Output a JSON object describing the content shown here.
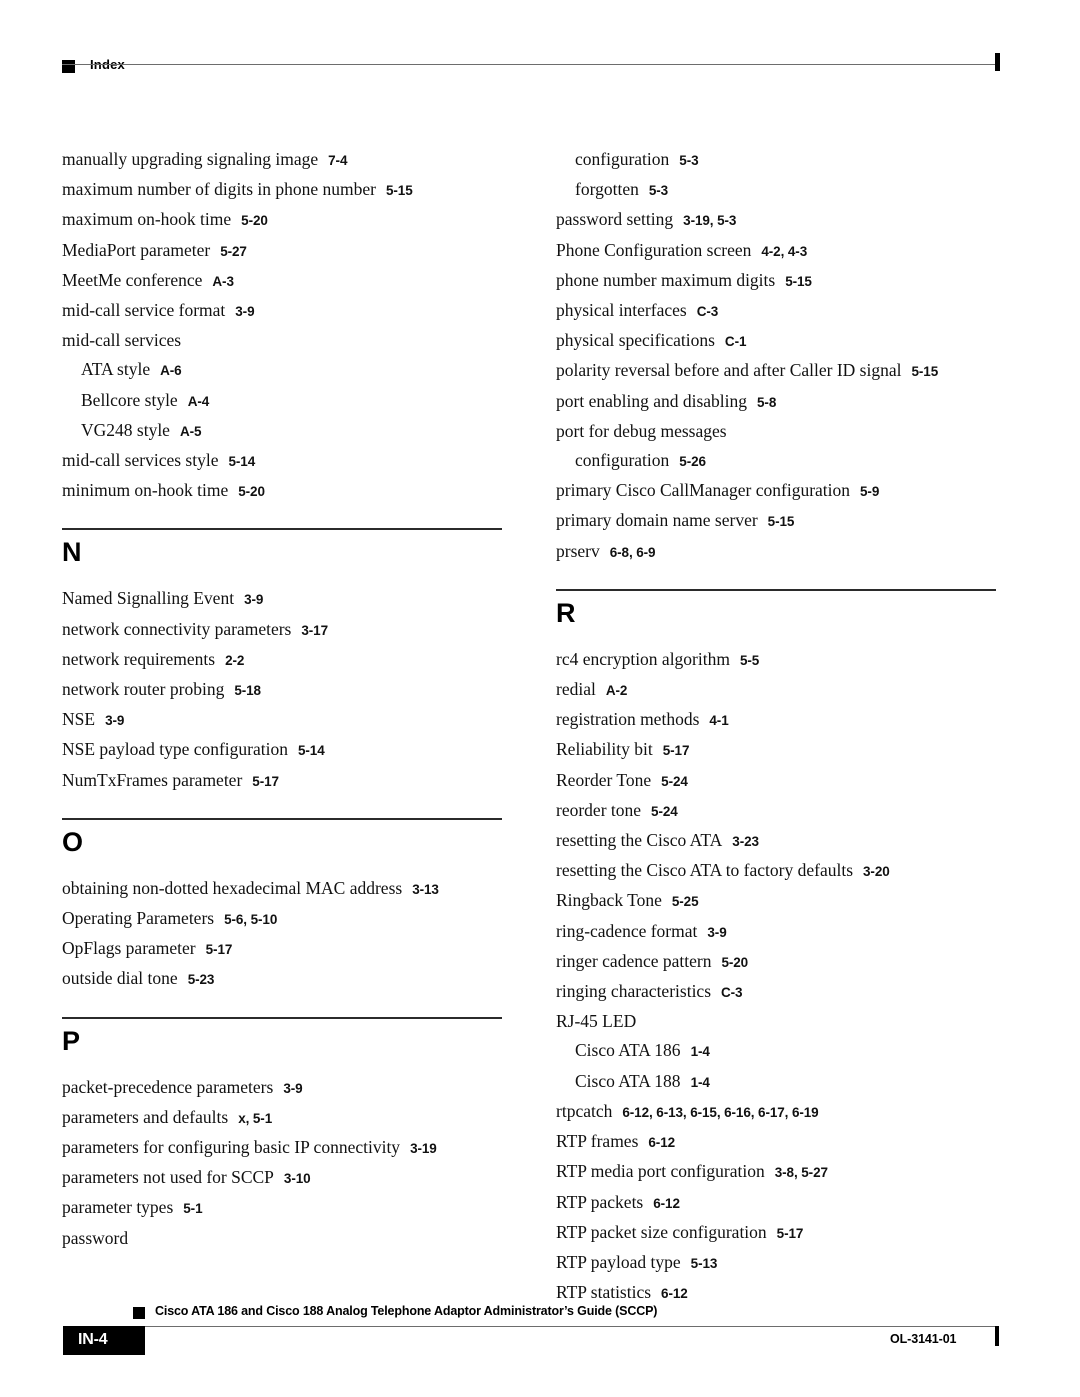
{
  "header": {
    "label": "Index"
  },
  "columns": {
    "left": [
      {
        "kind": "entry",
        "level": 1,
        "term": "manually upgrading signaling image",
        "locs": "7-4"
      },
      {
        "kind": "entry",
        "level": 1,
        "term": "maximum number of digits in phone number",
        "locs": "5-15"
      },
      {
        "kind": "entry",
        "level": 1,
        "term": "maximum on-hook time",
        "locs": "5-20"
      },
      {
        "kind": "entry",
        "level": 1,
        "term": "MediaPort parameter",
        "locs": "5-27"
      },
      {
        "kind": "entry",
        "level": 1,
        "term": "MeetMe conference",
        "locs": "A-3"
      },
      {
        "kind": "entry",
        "level": 1,
        "term": "mid-call service format",
        "locs": "3-9"
      },
      {
        "kind": "entry",
        "level": 1,
        "term": "mid-call services",
        "locs": ""
      },
      {
        "kind": "entry",
        "level": 2,
        "term": "ATA style",
        "locs": "A-6"
      },
      {
        "kind": "entry",
        "level": 2,
        "term": "Bellcore style",
        "locs": "A-4"
      },
      {
        "kind": "entry",
        "level": 2,
        "term": "VG248 style",
        "locs": "A-5"
      },
      {
        "kind": "entry",
        "level": 1,
        "term": "mid-call services style",
        "locs": "5-14"
      },
      {
        "kind": "entry",
        "level": 1,
        "term": "minimum on-hook time",
        "locs": "5-20"
      },
      {
        "kind": "group",
        "letter": "N"
      },
      {
        "kind": "entry",
        "level": 1,
        "term": "Named Signalling Event",
        "locs": "3-9"
      },
      {
        "kind": "entry",
        "level": 1,
        "term": "network connectivity parameters",
        "locs": "3-17"
      },
      {
        "kind": "entry",
        "level": 1,
        "term": "network requirements",
        "locs": "2-2"
      },
      {
        "kind": "entry",
        "level": 1,
        "term": "network router probing",
        "locs": "5-18"
      },
      {
        "kind": "entry",
        "level": 1,
        "term": "NSE",
        "locs": "3-9"
      },
      {
        "kind": "entry",
        "level": 1,
        "term": "NSE payload type configuration",
        "locs": "5-14"
      },
      {
        "kind": "entry",
        "level": 1,
        "term": "NumTxFrames parameter",
        "locs": "5-17"
      },
      {
        "kind": "group",
        "letter": "O"
      },
      {
        "kind": "entry",
        "level": 1,
        "term": "obtaining non-dotted hexadecimal MAC address",
        "locs": "3-13"
      },
      {
        "kind": "entry",
        "level": 1,
        "term": "Operating Parameters",
        "locs": "5-6, 5-10"
      },
      {
        "kind": "entry",
        "level": 1,
        "term": "OpFlags parameter",
        "locs": "5-17"
      },
      {
        "kind": "entry",
        "level": 1,
        "term": "outside dial tone",
        "locs": "5-23"
      },
      {
        "kind": "group",
        "letter": "P"
      },
      {
        "kind": "entry",
        "level": 1,
        "term": "packet-precedence parameters",
        "locs": "3-9"
      },
      {
        "kind": "entry",
        "level": 1,
        "term": "parameters and defaults",
        "locs": "x, 5-1"
      },
      {
        "kind": "entry",
        "level": 1,
        "term": "parameters for configuring basic IP connectivity",
        "locs": "3-19"
      },
      {
        "kind": "entry",
        "level": 1,
        "term": "parameters not used for SCCP",
        "locs": "3-10"
      },
      {
        "kind": "entry",
        "level": 1,
        "term": "parameter types",
        "locs": "5-1"
      },
      {
        "kind": "entry",
        "level": 1,
        "term": "password",
        "locs": ""
      }
    ],
    "right": [
      {
        "kind": "entry",
        "level": 2,
        "term": "configuration",
        "locs": "5-3"
      },
      {
        "kind": "entry",
        "level": 2,
        "term": "forgotten",
        "locs": "5-3"
      },
      {
        "kind": "entry",
        "level": 1,
        "term": "password setting",
        "locs": "3-19, 5-3"
      },
      {
        "kind": "entry",
        "level": 1,
        "term": "Phone Configuration screen",
        "locs": "4-2, 4-3"
      },
      {
        "kind": "entry",
        "level": 1,
        "term": "phone number maximum digits",
        "locs": "5-15"
      },
      {
        "kind": "entry",
        "level": 1,
        "term": "physical interfaces",
        "locs": "C-3"
      },
      {
        "kind": "entry",
        "level": 1,
        "term": "physical specifications",
        "locs": "C-1"
      },
      {
        "kind": "entry",
        "level": 1,
        "term": "polarity reversal before and after Caller ID signal",
        "locs": "5-15"
      },
      {
        "kind": "entry",
        "level": 1,
        "term": "port enabling and disabling",
        "locs": "5-8"
      },
      {
        "kind": "entry",
        "level": 1,
        "term": "port for debug messages",
        "locs": ""
      },
      {
        "kind": "entry",
        "level": 2,
        "term": "configuration",
        "locs": "5-26"
      },
      {
        "kind": "entry",
        "level": 1,
        "term": "primary Cisco CallManager configuration",
        "locs": "5-9"
      },
      {
        "kind": "entry",
        "level": 1,
        "term": "primary domain name server",
        "locs": "5-15"
      },
      {
        "kind": "entry",
        "level": 1,
        "term": "prserv",
        "locs": "6-8, 6-9"
      },
      {
        "kind": "group",
        "letter": "R"
      },
      {
        "kind": "entry",
        "level": 1,
        "term": "rc4 encryption algorithm",
        "locs": "5-5"
      },
      {
        "kind": "entry",
        "level": 1,
        "term": "redial",
        "locs": "A-2"
      },
      {
        "kind": "entry",
        "level": 1,
        "term": "registration methods",
        "locs": "4-1"
      },
      {
        "kind": "entry",
        "level": 1,
        "term": "Reliability bit",
        "locs": "5-17"
      },
      {
        "kind": "entry",
        "level": 1,
        "term": "Reorder Tone",
        "locs": "5-24"
      },
      {
        "kind": "entry",
        "level": 1,
        "term": "reorder tone",
        "locs": "5-24"
      },
      {
        "kind": "entry",
        "level": 1,
        "term": "resetting the Cisco ATA",
        "locs": "3-23"
      },
      {
        "kind": "entry",
        "level": 1,
        "term": "resetting the Cisco ATA to factory defaults",
        "locs": "3-20"
      },
      {
        "kind": "entry",
        "level": 1,
        "term": "Ringback Tone",
        "locs": "5-25"
      },
      {
        "kind": "entry",
        "level": 1,
        "term": "ring-cadence format",
        "locs": "3-9"
      },
      {
        "kind": "entry",
        "level": 1,
        "term": "ringer cadence pattern",
        "locs": "5-20"
      },
      {
        "kind": "entry",
        "level": 1,
        "term": "ringing characteristics",
        "locs": "C-3"
      },
      {
        "kind": "entry",
        "level": 1,
        "term": "RJ-45 LED",
        "locs": ""
      },
      {
        "kind": "entry",
        "level": 2,
        "term": "Cisco ATA 186",
        "locs": "1-4"
      },
      {
        "kind": "entry",
        "level": 2,
        "term": "Cisco ATA 188",
        "locs": "1-4"
      },
      {
        "kind": "entry",
        "level": 1,
        "term": "rtpcatch",
        "locs": "6-12, 6-13, 6-15, 6-16, 6-17, 6-19"
      },
      {
        "kind": "entry",
        "level": 1,
        "term": "RTP frames",
        "locs": "6-12"
      },
      {
        "kind": "entry",
        "level": 1,
        "term": "RTP media port configuration",
        "locs": "3-8, 5-27"
      },
      {
        "kind": "entry",
        "level": 1,
        "term": "RTP packets",
        "locs": "6-12"
      },
      {
        "kind": "entry",
        "level": 1,
        "term": "RTP packet size configuration",
        "locs": "5-17"
      },
      {
        "kind": "entry",
        "level": 1,
        "term": "RTP payload type",
        "locs": "5-13"
      },
      {
        "kind": "entry",
        "level": 1,
        "term": "RTP statistics",
        "locs": "6-12"
      }
    ]
  },
  "footer": {
    "title": "Cisco ATA 186 and Cisco 188 Analog Telephone Adaptor Administrator’s Guide (SCCP)",
    "page_number": "IN-4",
    "doc_id": "OL-3141-01"
  }
}
